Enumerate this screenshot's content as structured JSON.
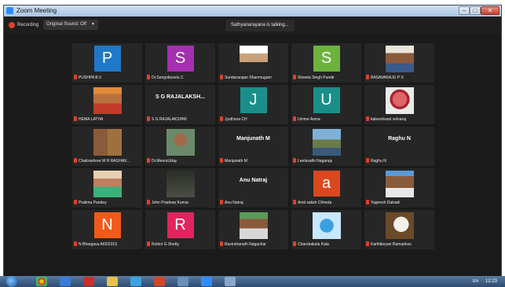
{
  "window": {
    "title": "Zoom Meeting"
  },
  "topbar": {
    "recording_label": "Recording",
    "sound_label": "Original Sound: Off",
    "talking": "Sathyanarayana is talking..."
  },
  "participants": [
    {
      "name": "PUSHPA B.V",
      "avatar": "P",
      "avatar_color": "#1f78c8",
      "kind": "letter"
    },
    {
      "name": "Dr.Sengottuvelu C",
      "avatar": "S",
      "avatar_color": "#a52fb0",
      "kind": "letter"
    },
    {
      "name": "Sundararajan Shanmugam",
      "kind": "photo",
      "photo": "man-suit"
    },
    {
      "name": "Shweta Singh Pundir",
      "avatar": "S",
      "avatar_color": "#6cb33e",
      "kind": "letter"
    },
    {
      "name": "BASAVARAJU P S",
      "kind": "photo",
      "photo": "man-mustache"
    },
    {
      "name": "HEMA LATHA",
      "kind": "photo",
      "photo": "woman-warm"
    },
    {
      "name": "S G RAJALAKSHMI",
      "display": "S G RAJALAKSH...",
      "kind": "text"
    },
    {
      "name": "Jyothsna CH",
      "avatar": "J",
      "avatar_color": "#1a8f8a",
      "kind": "letter"
    },
    {
      "name": "Umme Asma",
      "avatar": "U",
      "avatar_color": "#1a8f8a",
      "kind": "letter"
    },
    {
      "name": "kaleeshwari selvaraj",
      "kind": "photo",
      "photo": "rose"
    },
    {
      "name": "Chaitrashree M R RAGHAV...",
      "kind": "photo",
      "photo": "couple"
    },
    {
      "name": "Dr.MeeraUday",
      "kind": "photo",
      "photo": "woman-portrait"
    },
    {
      "name": "Manjunath M",
      "display": "Manjunath M",
      "kind": "text"
    },
    {
      "name": "Leelavathi Nagaraju",
      "kind": "photo",
      "photo": "landscape"
    },
    {
      "name": "Raghu N",
      "display": "Raghu N",
      "kind": "text"
    },
    {
      "name": "Pratima Pandey",
      "kind": "photo",
      "photo": "woman-green"
    },
    {
      "name": "John Pradeep Kumar",
      "kind": "photo",
      "photo": "book-cover"
    },
    {
      "name": "Anu Natraj",
      "display": "Anu Natraj",
      "kind": "text"
    },
    {
      "name": "Amit satish Chheda",
      "avatar": "a",
      "avatar_color": "#d9481f",
      "kind": "letter"
    },
    {
      "name": "Yagnesh Dalvadi",
      "kind": "photo",
      "photo": "man-blue"
    },
    {
      "name": "N Bhargava AI002319",
      "avatar": "N",
      "avatar_color": "#f05a1a",
      "kind": "letter"
    },
    {
      "name": "Rohini G Shetty",
      "avatar": "R",
      "avatar_color": "#e0245e",
      "kind": "letter"
    },
    {
      "name": "Ravindranath Nagachar",
      "kind": "photo",
      "photo": "man-outdoor"
    },
    {
      "name": "Chandrakala Kala",
      "kind": "photo",
      "photo": "butterfly"
    },
    {
      "name": "Karthikeyan Ramadoss",
      "kind": "photo",
      "photo": "horse"
    }
  ],
  "taskbar": {
    "tray_text": "EN",
    "clock": "12:23"
  }
}
